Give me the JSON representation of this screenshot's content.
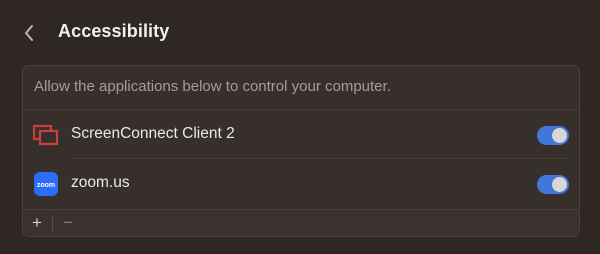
{
  "header": {
    "title": "Accessibility",
    "back_icon": "chevron-left-icon"
  },
  "panel": {
    "description": "Allow the applications below to control your computer.",
    "apps": [
      {
        "name": "ScreenConnect Client 2",
        "icon": "screenconnect-icon",
        "enabled": true
      },
      {
        "name": "zoom.us",
        "icon": "zoom-icon",
        "icon_text": "zoom",
        "enabled": true
      }
    ]
  },
  "footer": {
    "add_label": "+",
    "remove_label": "−"
  },
  "colors": {
    "background": "#2e2724",
    "panel": "#372f2b",
    "toggle_on": "#3f78d8",
    "screenconnect_red": "#c8413b",
    "zoom_blue": "#2d6cf6"
  }
}
